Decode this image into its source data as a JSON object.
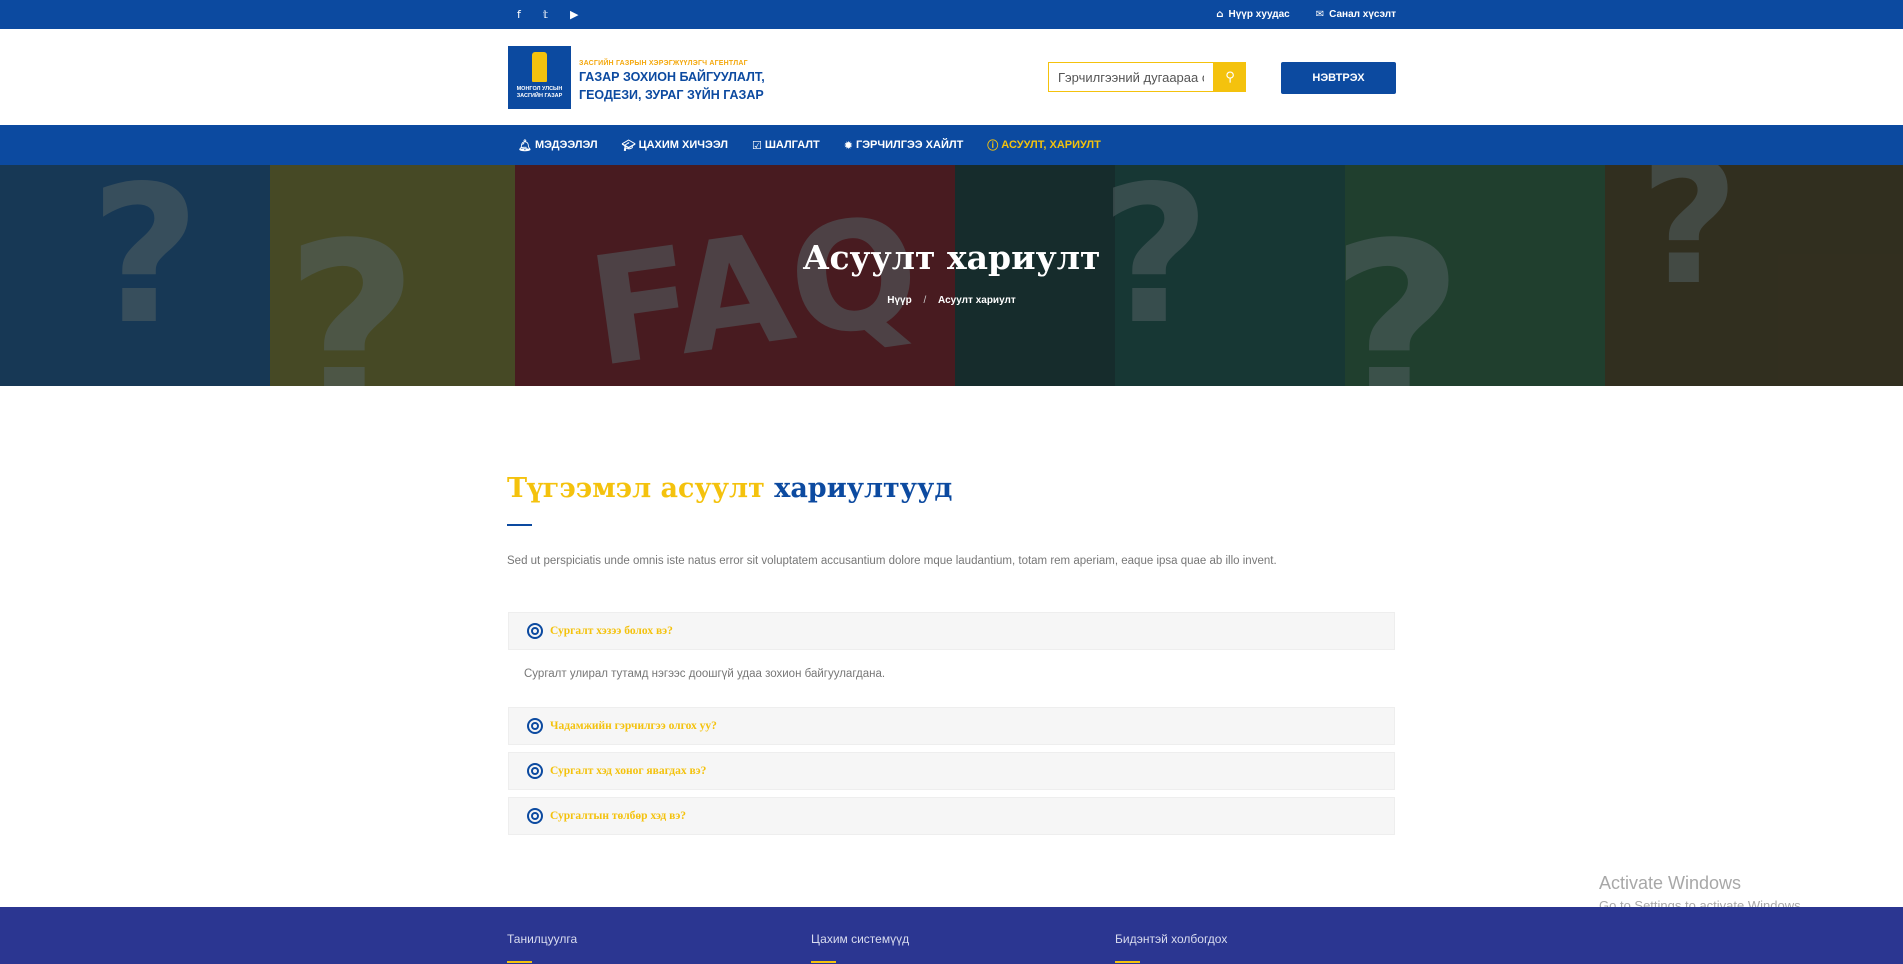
{
  "topbar": {
    "social_icons": [
      "facebook-icon",
      "twitter-icon",
      "youtube-icon"
    ],
    "links": [
      {
        "icon": "home-icon",
        "label": "Нүүр хуудас"
      },
      {
        "icon": "envelope-icon",
        "label": "Санал хүсэлт"
      }
    ]
  },
  "header": {
    "logo_caption": "МОНГОЛ УЛСЫН ЗАСГИЙН ГАЗАР",
    "logo_small": "ЗАСГИЙН ГАЗРЫН ХЭРЭГЖҮҮЛЭГЧ АГЕНТЛАГ",
    "logo_line1": "ГАЗАР ЗОХИОН БАЙГУУЛАЛТ,",
    "logo_line2": "ГЕОДЕЗИ, ЗУРАГ ЗҮЙН ГАЗАР",
    "search_placeholder": "Гэрчилгээний дугаараа оруулна уу",
    "login_label": "НЭВТРЭХ"
  },
  "nav": {
    "items": [
      {
        "icon": "bell-icon",
        "label": "МЭДЭЭЛЭЛ"
      },
      {
        "icon": "graduation-cap-icon",
        "label": "ЦАХИМ ХИЧЭЭЛ"
      },
      {
        "icon": "check-square-icon",
        "label": "ШАЛГАЛТ"
      },
      {
        "icon": "certificate-icon",
        "label": "ГЭРЧИЛГЭЭ ХАЙЛТ"
      },
      {
        "icon": "info-circle-icon",
        "label": "АСУУЛТ, ХАРИУЛТ"
      }
    ],
    "active_index": 4
  },
  "hero": {
    "title": "Асуулт хариулт",
    "breadcrumb_home": "Нүүр",
    "breadcrumb_sep": "/",
    "breadcrumb_current": "Асуулт хариулт"
  },
  "faq": {
    "title_yellow": "Түгээмэл асуулт",
    "title_blue": "хариултууд",
    "intro": "Sed ut perspiciatis unde omnis iste natus error sit voluptatem accusantium dolore mque laudantium, totam rem aperiam, eaque ipsa quae ab illo invent.",
    "items": [
      {
        "question": "Сургалт хэзээ болох вэ?",
        "answer": "Сургалт улирал тутамд нэгээс доошгүй удаа зохион байгуулагдана.",
        "expanded": true
      },
      {
        "question": "Чадамжийн гэрчилгээ олгох уу?",
        "expanded": false
      },
      {
        "question": "Сургалт хэд хоног явагдах вэ?",
        "expanded": false
      },
      {
        "question": "Сургалтын төлбөр хэд вэ?",
        "expanded": false
      }
    ]
  },
  "watermark": {
    "line1": "Activate Windows",
    "line2": "Go to Settings to activate Windows."
  },
  "footer": {
    "columns": [
      "Танилцуулга",
      "Цахим системүүд",
      "Бидэнтэй холбогдох"
    ]
  },
  "colors": {
    "brand_blue": "#0c4aa0",
    "accent_yellow": "#f4c20d",
    "footer_blue": "#2b3691"
  }
}
